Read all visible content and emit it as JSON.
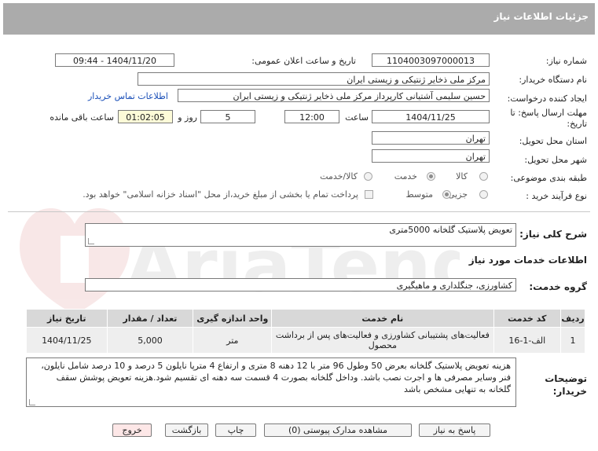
{
  "header": {
    "title": "جزئیات اطلاعات نیاز"
  },
  "fields": {
    "need_number_label": "شماره نیاز:",
    "need_number": "1104003097000013",
    "announce_label": "تاریخ و ساعت اعلان عمومی:",
    "announce_value": "1404/11/20 - 09:44",
    "buyer_org_label": "نام دستگاه خریدار:",
    "buyer_org": "مرکز ملی ذخایر ژنتیکی و زیستی ایران",
    "creator_label": "ایجاد کننده درخواست:",
    "creator": "حسین  سلیمی آشتیانی  کارپرداز مرکز ملی ذخایر ژنتیکی و زیستی ایران",
    "contact_link": "اطلاعات تماس خریدار",
    "deadline_label": "مهلت ارسال پاسخ: تا تاریخ:",
    "deadline_date": "1404/11/25",
    "time_label": "ساعت",
    "deadline_time": "12:00",
    "days_value": "5",
    "days_label": "روز و",
    "remaining_time": "01:02:05",
    "remaining_label": "ساعت باقی مانده",
    "province_label": "استان محل تحویل:",
    "province": "تهران",
    "city_label": "شهر محل تحویل:",
    "city": "تهران",
    "category_label": "طبقه بندی موضوعی:",
    "category_options": [
      "کالا",
      "خدمت",
      "کالا/خدمت"
    ],
    "category_selected": "خدمت",
    "process_label": "نوع فرآیند خرید :",
    "process_options": [
      "جزیی",
      "متوسط"
    ],
    "payment_text": "پرداخت تمام یا بخشی از مبلغ خرید،از محل \"اسناد خزانه اسلامی\" خواهد بود."
  },
  "summary": {
    "label": "شرح کلی نیاز:",
    "value": "تعویض پلاستیک گلخانه 5000متری"
  },
  "services_section": {
    "title": "اطلاعات خدمات مورد نیاز",
    "group_label": "گروه خدمت:",
    "group_value": "کشاورزی، جنگلداری و ماهیگیری"
  },
  "table": {
    "headers": [
      "ردیف",
      "کد خدمت",
      "نام خدمت",
      "واحد اندازه گیری",
      "تعداد / مقدار",
      "تاریخ نیاز"
    ],
    "rows": [
      [
        "1",
        "الف-1-16",
        "فعالیت‌های پشتیبانی کشاورزی و فعالیت‌های پس از برداشت محصول",
        "متر",
        "5,000",
        "1404/11/25"
      ]
    ]
  },
  "description": {
    "label": "توضیحات خریدار:",
    "text": "هزینه تعویض پلاستیک گلخانه بعرض 50 وطول 96 متر با 12 دهنه 8 متری و ارتفاع 4 مترپا نایلون 5 درصد و 10 درصد شامل نایلون، فنر وسایر مصرفی ها و اجرت نصب باشد. وداخل گلخانه بصورت 4 قسمت سه دهنه ای تقسیم شود.هزینه تعویض پوشش سقف گلخانه به تنهایی مشخص باشد"
  },
  "buttons": {
    "reply": "پاسخ به نیاز",
    "attachments": "مشاهده مدارک پیوستی (0)",
    "print": "چاپ",
    "back": "بازگشت",
    "exit": "خروج"
  },
  "watermark": {
    "brand": "AriaTender.net"
  },
  "colors": {
    "header_bg": "#ababab",
    "link": "#1a4fb8",
    "remaining_bg": "#fdfbd8",
    "exit_bg": "#fde7e7"
  }
}
